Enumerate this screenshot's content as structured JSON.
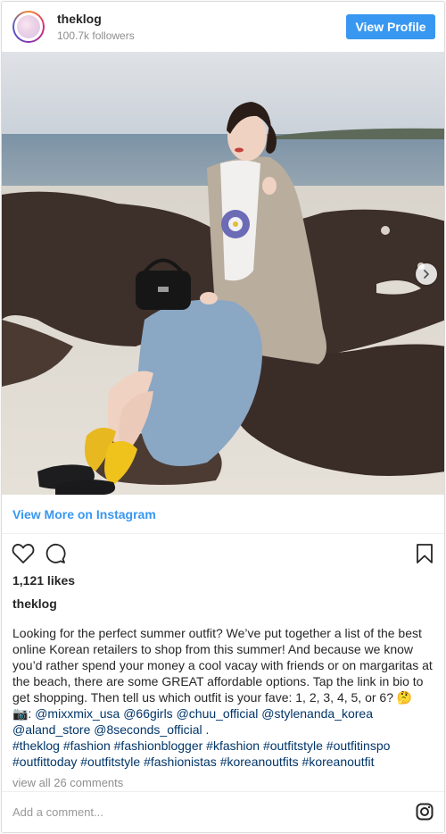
{
  "header": {
    "username": "theklog",
    "followers": "100.7k followers",
    "view_profile_label": "View Profile"
  },
  "media": {
    "alt": "",
    "carousel_next_icon": "chevron-right-icon"
  },
  "view_more_label": "View More on Instagram",
  "actions": {
    "like_icon": "heart-icon",
    "comment_icon": "comment-icon",
    "save_icon": "bookmark-icon"
  },
  "likes": "1,121 likes",
  "caption": {
    "username": "theklog",
    "text": "Looking for the perfect summer outfit? We’ve put together a list of the best online Korean retailers to shop from this summer! And because we know you’d rather spend your money a cool vacay with friends or on margaritas at the beach, there are some GREAT affordable options. Tap the link in bio to get shopping. Then tell us which outfit is your fave: 1, 2, 3, 4, 5, or 6? 🤔",
    "mentions_prefix": "📷: ",
    "mentions": "@mixxmix_usa @66girls @chuu_official @stylenanda_korea @aland_store @8seconds_official .",
    "hashtags": "#theklog #fashion #fashionblogger #kfashion #outfitstyle #outfitinspo #outfittoday #outfitstyle #fashionistas #koreanoutfits #koreanoutfit"
  },
  "comments_label": "view all 26 comments",
  "add_comment_placeholder": "Add a comment...",
  "footer_icon": "instagram-icon",
  "colors": {
    "accent": "#3897f0",
    "link": "#003569",
    "muted": "#8e8e8e"
  }
}
